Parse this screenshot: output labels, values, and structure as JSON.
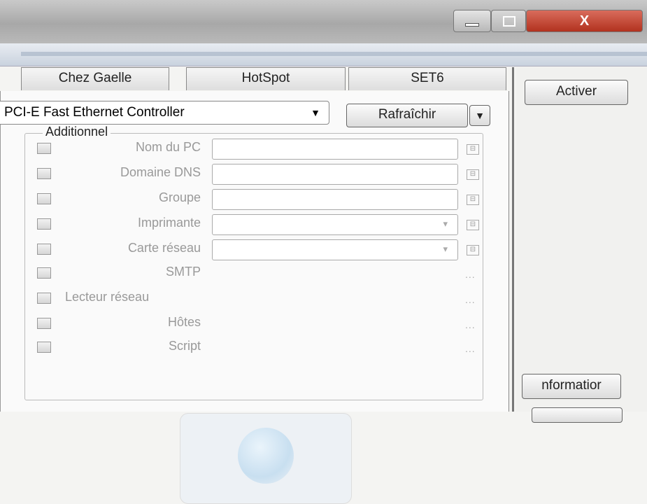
{
  "window": {
    "close_glyph": "X"
  },
  "tabs": [
    "Chez Gaelle",
    "HotSpot",
    "SET6"
  ],
  "adapter": {
    "selected": "PCI-E Fast Ethernet Controller"
  },
  "buttons": {
    "refresh": "Rafraîchir",
    "activate": "Activer",
    "information": "nformatior"
  },
  "group": {
    "title": "Additionnel",
    "rows": [
      {
        "label": "Nom du PC",
        "kind": "text"
      },
      {
        "label": "Domaine DNS",
        "kind": "text"
      },
      {
        "label": "Groupe",
        "kind": "text"
      },
      {
        "label": "Imprimante",
        "kind": "select"
      },
      {
        "label": "Carte réseau",
        "kind": "select"
      },
      {
        "label": "SMTP",
        "kind": "dots"
      },
      {
        "label": "Lecteur réseau",
        "kind": "dots"
      },
      {
        "label": "Hôtes",
        "kind": "dots"
      },
      {
        "label": "Script",
        "kind": "dots"
      }
    ],
    "dots": "..."
  }
}
